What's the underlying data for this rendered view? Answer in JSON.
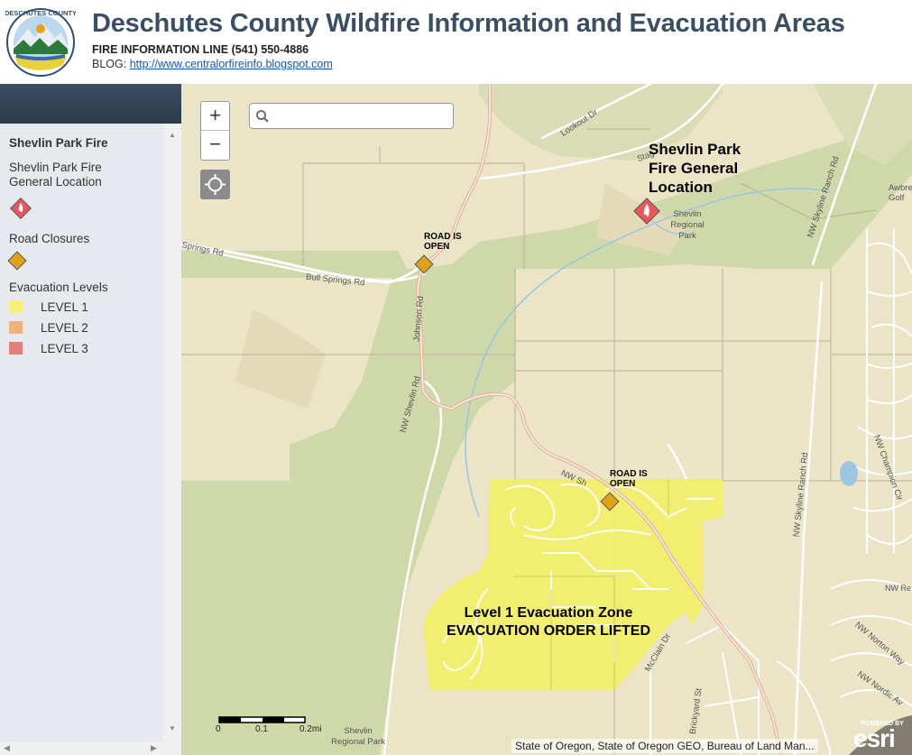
{
  "header": {
    "logo_text": "DESCHUTES COUNTY",
    "title": "Deschutes County Wildfire Information and Evacuation Areas",
    "fire_line": "FIRE INFORMATION LINE (541) 550-4886",
    "blog_label": "BLOG: ",
    "blog_url": "http://www.centralorfireinfo.blogspot.com"
  },
  "legend": {
    "layer_title": "Shevlin Park Fire",
    "fire_location_label": "Shevlin Park Fire General Location",
    "road_closures_label": "Road Closures",
    "evac_title": "Evacuation Levels",
    "levels": [
      {
        "label": "LEVEL 1",
        "color": "#f4f07a"
      },
      {
        "label": "LEVEL 2",
        "color": "#f0b27c"
      },
      {
        "label": "LEVEL 3",
        "color": "#e67d7d"
      }
    ]
  },
  "map": {
    "search_placeholder": "",
    "zoom_in": "+",
    "zoom_out": "−",
    "fire_label": "Shevlin Park Fire General Location",
    "fire_label_lines": [
      "Shevlin Park",
      "Fire General",
      "Location"
    ],
    "road_open_1": [
      "ROAD IS",
      "OPEN"
    ],
    "road_open_2": [
      "ROAD IS",
      "OPEN"
    ],
    "evac_zone": [
      "Level 1 Evacuation Zone",
      "EVACUATION ORDER LIFTED"
    ],
    "streets": {
      "lookout": "Lookout Dr",
      "stag": "Stag",
      "shevlin_park_top": "Shevlin Regional Park",
      "bull_springs_1": "Springs Rd",
      "bull_springs_2": "Bull Springs Rd",
      "johnson": "Johnson Rd",
      "nw_shevlin": "NW Shevlin Rd",
      "nw_shevlin_2": "NW Sh",
      "skyline_1": "NW Skyline Ranch Rd",
      "skyline_2": "NW Skyline Ranch Rd",
      "champion": "NW Champion Cir",
      "mcclain": "McClain Dr",
      "awbrey": "Awbre Golf",
      "nw_re": "NW Re",
      "norton": "NW Norton Way",
      "nordic": "NW Nordic Av",
      "brickyard": "Brickyard St",
      "shevlin_park_bottom": "Shevlin Regional Park"
    },
    "scale": {
      "labels": [
        "0",
        "0.1",
        "0.2mi"
      ]
    },
    "attribution": "State of Oregon, State of Oregon GEO, Bureau of Land Man...",
    "esri_powered": "POWERED BY",
    "esri": "esri"
  }
}
